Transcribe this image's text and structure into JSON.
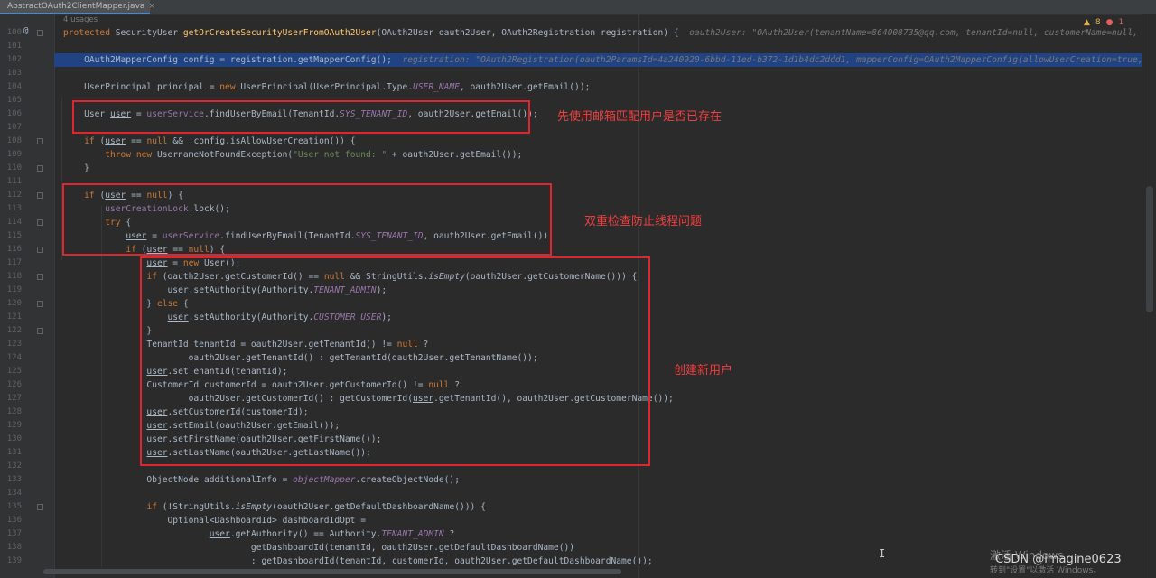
{
  "tab": {
    "filename": "AbstractOAuth2ClientMapper.java",
    "close": "×"
  },
  "usages": "4 usages",
  "inspections": {
    "warnings": "8",
    "errors": "1",
    "warn_icon": "warning-triangle-icon",
    "err_icon": "error-icon"
  },
  "gutter_marker": "@",
  "lines": [
    {
      "n": "100",
      "html": "<span class='kw'>protected</span> SecurityUser <span class='fn'>getOrCreateSecurityUserFromOAuth2User</span>(OAuth2User oauth2User, OAuth2Registration registration) {  <span class='hint'>oauth2User: \"OAuth2User(tenantName=864008735@qq.com, tenantId=null, customerName=null, customerId=nu</span>"
    },
    {
      "n": "101",
      "html": ""
    },
    {
      "n": "102",
      "html": "    OAuth2MapperConfig config = registration.getMapperConfig();  <span class='hint'>registration: \"OAuth2Registration(oauth2ParamsId=4a240920-6bbd-11ed-b372-1d1b4dc2ddd1, mapperConfig=OAuth2MapperConfig(allowUserCreation=true, activateUse</span>",
      "hl": true
    },
    {
      "n": "103",
      "html": ""
    },
    {
      "n": "104",
      "html": "    UserPrincipal principal = <span class='kw'>new</span> UserPrincipal(UserPrincipal.Type.<span class='cst'>USER_NAME</span>, oauth2User.getEmail());"
    },
    {
      "n": "105",
      "html": ""
    },
    {
      "n": "106",
      "html": "    User <span class='ul'>user</span> = <span class='fld'>userService</span>.findUserByEmail(TenantId.<span class='cst'>SYS_TENANT_ID</span>, oauth2User.getEmail());"
    },
    {
      "n": "107",
      "html": ""
    },
    {
      "n": "108",
      "html": "    <span class='kw'>if</span> (<span class='ul'>user</span> == <span class='kw'>null</span> &amp;&amp; !config.isAllowUserCreation()) {"
    },
    {
      "n": "109",
      "html": "        <span class='kw'>throw new</span> UsernameNotFoundException(<span class='str'>\"User not found: \"</span> + oauth2User.getEmail());"
    },
    {
      "n": "110",
      "html": "    }"
    },
    {
      "n": "111",
      "html": ""
    },
    {
      "n": "112",
      "html": "    <span class='kw'>if</span> (<span class='ul'>user</span> == <span class='kw'>null</span>) {"
    },
    {
      "n": "113",
      "html": "        <span class='fld'>userCreationLock</span>.lock();"
    },
    {
      "n": "114",
      "html": "        <span class='kw'>try</span> {"
    },
    {
      "n": "115",
      "html": "            <span class='ul'>user</span> = <span class='fld'>userService</span>.findUserByEmail(TenantId.<span class='cst'>SYS_TENANT_ID</span>, oauth2User.getEmail());"
    },
    {
      "n": "116",
      "html": "            <span class='kw'>if</span> (<span class='ul'>user</span> == <span class='kw'>null</span>) {"
    },
    {
      "n": "117",
      "html": "                <span class='ul'>user</span> = <span class='kw'>new</span> User();"
    },
    {
      "n": "118",
      "html": "                <span class='kw'>if</span> (oauth2User.getCustomerId() == <span class='kw'>null</span> &amp;&amp; StringUtils.<span class='st'>isEmpty</span>(oauth2User.getCustomerName())) {"
    },
    {
      "n": "119",
      "html": "                    <span class='ul'>user</span>.setAuthority(Authority.<span class='cst'>TENANT_ADMIN</span>);"
    },
    {
      "n": "120",
      "html": "                } <span class='kw'>else</span> {"
    },
    {
      "n": "121",
      "html": "                    <span class='ul'>user</span>.setAuthority(Authority.<span class='cst'>CUSTOMER_USER</span>);"
    },
    {
      "n": "122",
      "html": "                }"
    },
    {
      "n": "123",
      "html": "                TenantId tenantId = oauth2User.getTenantId() != <span class='kw'>null</span> ?"
    },
    {
      "n": "124",
      "html": "                        oauth2User.getTenantId() : getTenantId(oauth2User.getTenantName());"
    },
    {
      "n": "125",
      "html": "                <span class='ul'>user</span>.setTenantId(tenantId);"
    },
    {
      "n": "126",
      "html": "                CustomerId customerId = oauth2User.getCustomerId() != <span class='kw'>null</span> ?"
    },
    {
      "n": "127",
      "html": "                        oauth2User.getCustomerId() : getCustomerId(<span class='ul'>user</span>.getTenantId(), oauth2User.getCustomerName());"
    },
    {
      "n": "128",
      "html": "                <span class='ul'>user</span>.setCustomerId(customerId);"
    },
    {
      "n": "129",
      "html": "                <span class='ul'>user</span>.setEmail(oauth2User.getEmail());"
    },
    {
      "n": "130",
      "html": "                <span class='ul'>user</span>.setFirstName(oauth2User.getFirstName());"
    },
    {
      "n": "131",
      "html": "                <span class='ul'>user</span>.setLastName(oauth2User.getLastName());"
    },
    {
      "n": "132",
      "html": ""
    },
    {
      "n": "133",
      "html": "                ObjectNode additionalInfo = <span class='fld st'>objectMapper</span>.createObjectNode();"
    },
    {
      "n": "134",
      "html": ""
    },
    {
      "n": "135",
      "html": "                <span class='kw'>if</span> (!StringUtils.<span class='st'>isEmpty</span>(oauth2User.getDefaultDashboardName())) {"
    },
    {
      "n": "136",
      "html": "                    Optional&lt;DashboardId&gt; dashboardIdOpt ="
    },
    {
      "n": "137",
      "html": "                            <span class='ul'>user</span>.getAuthority() == Authority.<span class='cst'>TENANT_ADMIN</span> ?"
    },
    {
      "n": "138",
      "html": "                                    getDashboardId(tenantId, oauth2User.getDefaultDashboardName())"
    },
    {
      "n": "139",
      "html": "                                    : getDashboardId(tenantId, customerId, oauth2User.getDefaultDashboardName());"
    }
  ],
  "annotations": {
    "note1": "先使用邮箱匹配用户是否已存在",
    "note2": "双重检查防止线程问题",
    "note3": "创建新用户"
  },
  "watermark": "CSDN @imagine0623",
  "activate_windows": {
    "line1": "激活 Windows",
    "line2": "转到\"设置\"以激活 Windows。"
  },
  "mouse_cursor": "I"
}
